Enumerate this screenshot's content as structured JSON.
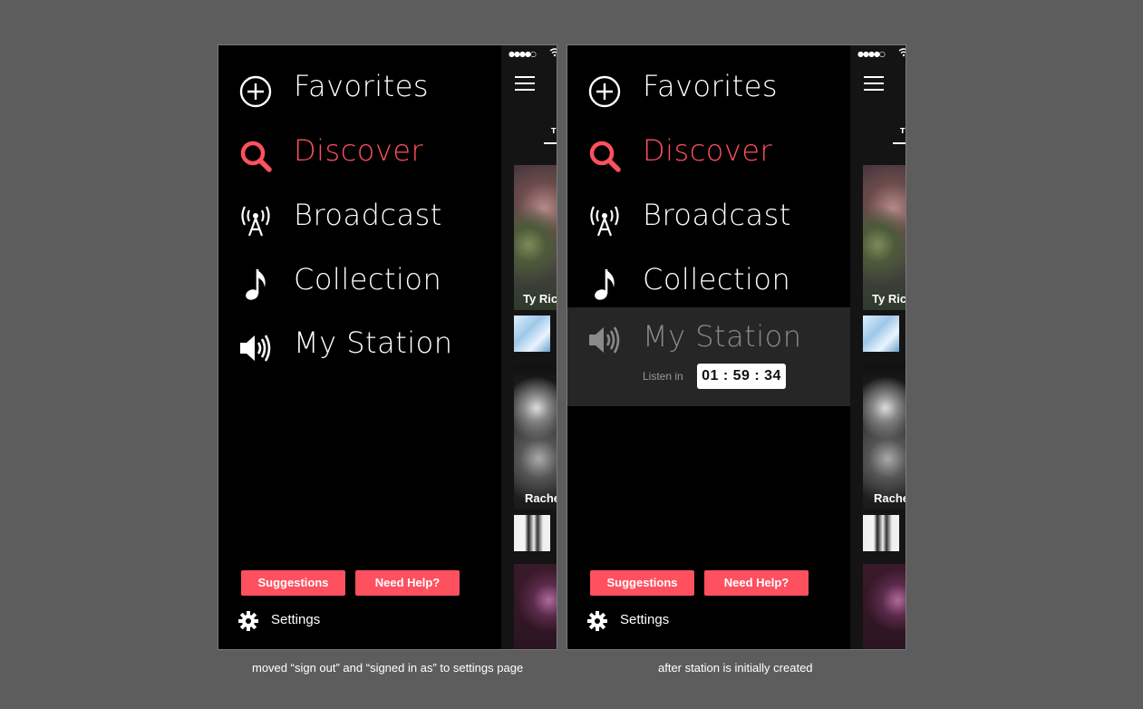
{
  "screens": [
    {
      "menu": {
        "favorites": "Favorites",
        "discover": "Discover",
        "broadcast": "Broadcast",
        "collection": "Collection",
        "my_station": "My Station"
      },
      "buttons": {
        "suggestions": "Suggestions",
        "need_help": "Need Help?"
      },
      "settings": "Settings",
      "peek": {
        "tab_fragment": "T",
        "card_1_label": "Ty Rich",
        "card_2_label": "Rache"
      },
      "caption": "moved “sign out” and “signed in as” to settings page"
    },
    {
      "menu": {
        "favorites": "Favorites",
        "discover": "Discover",
        "broadcast": "Broadcast",
        "collection": "Collection",
        "my_station": "My Station"
      },
      "station": {
        "listen_in": "Listen in",
        "countdown": "01 : 59 : 34"
      },
      "buttons": {
        "suggestions": "Suggestions",
        "need_help": "Need Help?"
      },
      "settings": "Settings",
      "peek": {
        "tab_fragment": "T",
        "card_1_label": "Ty Rich",
        "card_2_label": "Rache"
      },
      "caption": "after station is initially created"
    }
  ],
  "colors": {
    "accent": "#ff5060",
    "background": "#5d5d5d",
    "drawer": "#000000",
    "active_row": "#262626"
  },
  "icons": {
    "favorites": "plus-circle-icon",
    "discover": "search-icon",
    "broadcast": "antenna-icon",
    "collection": "music-note-icon",
    "my_station": "speaker-icon",
    "settings": "gear-icon",
    "menu": "hamburger-icon"
  }
}
